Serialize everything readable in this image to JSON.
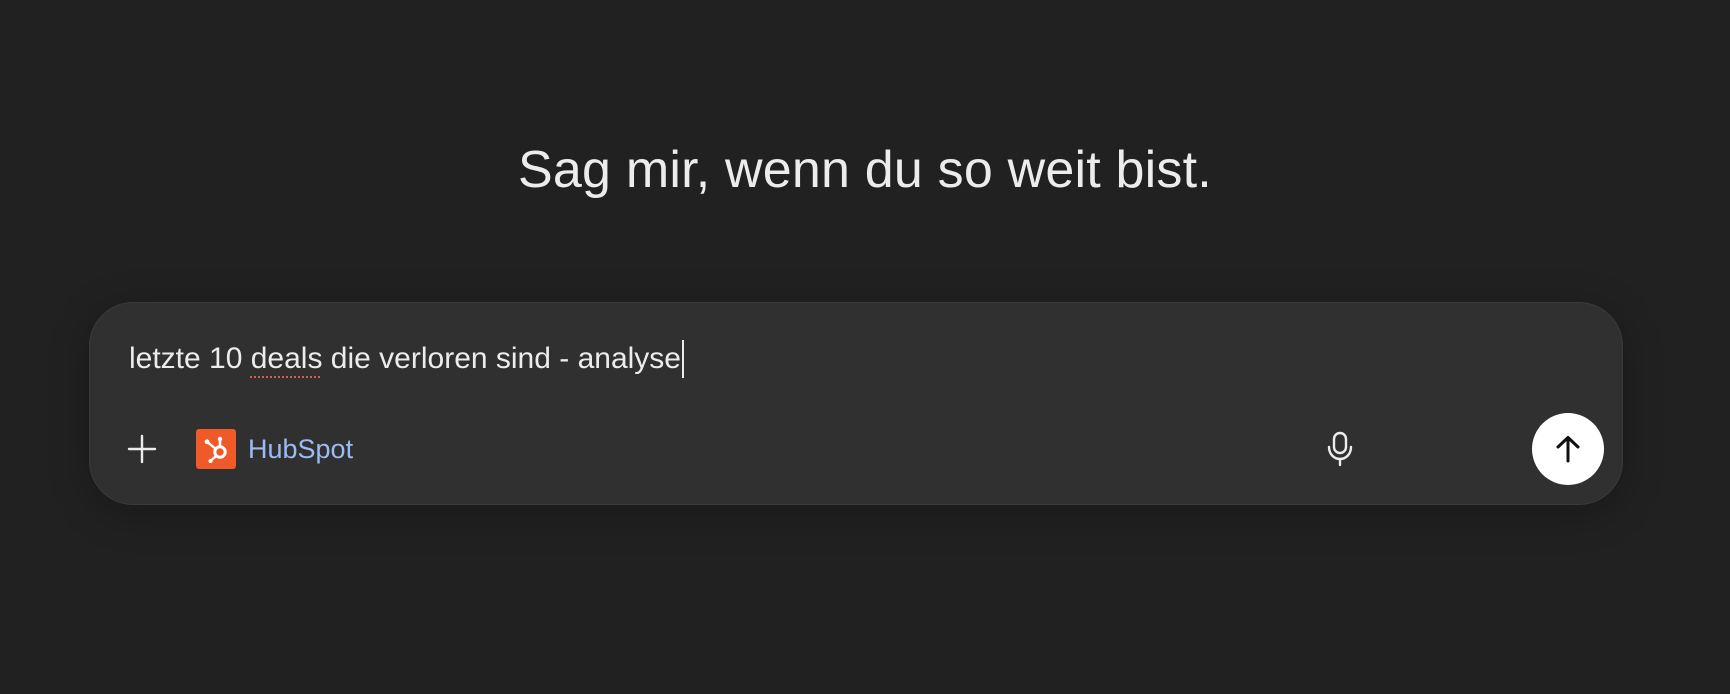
{
  "headline": "Sag mir, wenn du so weit bist.",
  "composer": {
    "prompt_before": "letzte 10 ",
    "prompt_misspelled": "deals",
    "prompt_after": " die verloren sind - analyse",
    "connector": {
      "label": "HubSpot",
      "brand_color": "#f05a28",
      "icon": "hubspot-logo-icon"
    },
    "icons": {
      "add": "plus-icon",
      "voice": "microphone-icon",
      "send": "arrow-up-icon"
    }
  },
  "colors": {
    "background": "#212121",
    "composer": "#303030",
    "link_text": "#9bbcf2",
    "send_button": "#ffffff"
  }
}
